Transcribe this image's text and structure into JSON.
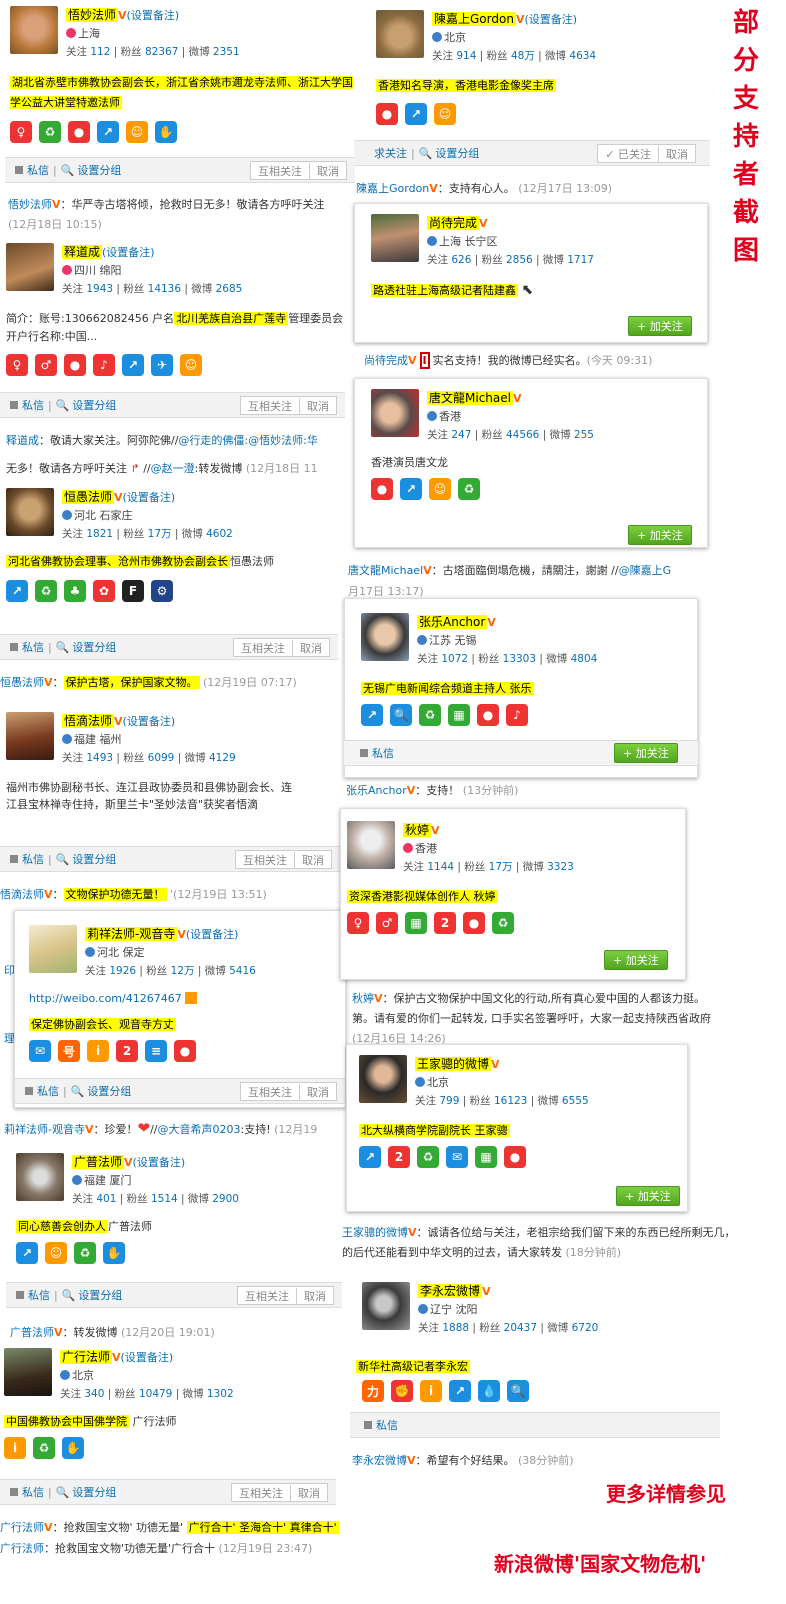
{
  "common": {
    "msg": "私信",
    "group": "设置分组",
    "mutual": "互相关注",
    "cancel": "取消",
    "already": "已关注",
    "follow_btn": "+ 加关注",
    "setnote": "(设置备注)",
    "city_beijing": "北京"
  },
  "cards": {
    "c1": {
      "name": "悟妙法师",
      "loc": "上海",
      "f": "112",
      "fans": "82367",
      "wb": "2351",
      "desc": "湖北省赤壁市佛教协会副会长，浙江省余姚市邇龙寺法师、浙江大学国学公益大讲堂特邀法师"
    },
    "c2": {
      "name": "陳嘉上Gordon",
      "loc": "北京",
      "f": "914",
      "fans": "48万",
      "wb": "4634",
      "desc": "香港知名导演，香港电影金像奖主席"
    },
    "c3": {
      "name": "释道成",
      "loc": "四川 绵阳",
      "f": "1943",
      "fans": "14136",
      "wb": "2685",
      "desc_a": "简介：账号:130662082456 户名",
      "desc_b": "北川羌族自治县广莲寺",
      "desc_c": "管理委员会 开户行名称:中国..."
    },
    "c4": {
      "name": "尚待完成",
      "loc": "上海 长宁区",
      "f": "626",
      "fans": "2856",
      "wb": "1717",
      "desc": "路透社驻上海高级记者陆建鑫"
    },
    "c5": {
      "name": "唐文龍Michael",
      "loc": "香港",
      "f": "247",
      "fans": "44566",
      "wb": "255",
      "desc": "香港演员唐文龙"
    },
    "c6": {
      "name": "恒愚法师",
      "loc": "河北 石家庄",
      "f": "1821",
      "fans": "17万",
      "wb": "4602",
      "desc_a": "河北省佛教协会理事、沧州市佛教协会副会长",
      "desc_b": "恒愚法师"
    },
    "c7": {
      "name": "张乐Anchor",
      "loc": "江苏 无锡",
      "f": "1072",
      "fans": "13303",
      "wb": "4804",
      "desc": "无锡广电新闻综合频道主持人 张乐"
    },
    "c8": {
      "name": "悟滴法师",
      "loc": "福建 福州",
      "f": "1493",
      "fans": "6099",
      "wb": "4129",
      "desc": "福州市佛协副秘书长、连江县政协委员和县佛协副会长、连江县宝林禅寺住持，斯里兰卡\"圣妙法音\"获奖者悟滴"
    },
    "c9": {
      "name": "秋婷",
      "loc": "香港",
      "f": "1144",
      "fans": "17万",
      "wb": "3323",
      "desc": "资深香港影视媒体创作人 秋婷"
    },
    "c10": {
      "name": "莉祥法师-观音寺",
      "loc": "河北 保定",
      "f": "1926",
      "fans": "12万",
      "wb": "5416",
      "url": "http://weibo.com/41267467",
      "desc": "保定佛协副会长、观音寺方丈"
    },
    "c11": {
      "name": "王家骢的微博",
      "loc": "北京",
      "f": "799",
      "fans": "16123",
      "wb": "6555",
      "desc": "北大纵横商学院副院长 王家骢"
    },
    "c12": {
      "name": "广普法师",
      "loc": "福建 厦门",
      "f": "401",
      "fans": "1514",
      "wb": "2900",
      "desc_a": "同心慈善会创办人",
      "desc_b": "广普法师"
    },
    "c13": {
      "name": "李永宏微博",
      "loc": "辽宁 沈阳",
      "f": "1888",
      "fans": "20437",
      "wb": "6720",
      "desc": "新华社高级记者李永宏"
    },
    "c14": {
      "name": "广行法师",
      "loc": "北京",
      "f": "340",
      "fans": "10479",
      "wb": "1302",
      "desc_a": "中国佛教协会中国佛学院",
      "desc_b": " 广行法师"
    }
  },
  "comments": {
    "m1": {
      "u": "悟妙法师",
      "t": "：华严寺古塔将倾，抢救时日无多！敬请各方呼吁关注",
      "d": "(12月18日 10:15)"
    },
    "m2": {
      "u": "陳嘉上Gordon",
      "t": "：支持有心人。",
      "d": "(12月17日 13:09)"
    },
    "m3": {
      "u": "释道成",
      "t": "：敬请大家关注。阿弥陀佛//",
      "t2": "@行走的佛僵",
      "t3": ":@悟妙法师:华",
      "line2": "无多！敬请各方呼吁关注",
      "line2b": "//",
      "line2c": "@赵一澄",
      "line2d": ":转发微博",
      "d": "(12月18日 11"
    },
    "m4": {
      "u": "尚待完成",
      "t": "实名支持！我的微博已经实名。",
      "d": "(今天 09:31)"
    },
    "m5": {
      "u": "唐文龍Michael",
      "t": "：古塔面臨倒塌危機，請關注，謝謝 //",
      "t2": "@陳嘉上G",
      "d": "月17日 13:17)"
    },
    "m6": {
      "u": "恒愚法师",
      "t": "：",
      "hl": "保护古塔，保护国家文物。",
      "d": "(12月19日 07:17)"
    },
    "m7": {
      "u": "张乐Anchor",
      "t": "：支持！",
      "d": "(13分钟前)"
    },
    "m8": {
      "u": "悟滴法师",
      "t": "：",
      "hl": "文物保护功德无量！",
      "d": "'(12月19日 13:51)"
    },
    "m9": {
      "u": "秋婷",
      "t": "：保护古文物保护中国文化的行动,所有真心爱中国的人都该力挺。",
      "line2": "第。请有爱的你们一起转发, 口手实名签署呼吁，大家一起支持陕西省政府",
      "d": "(12月16日 14:26)"
    },
    "m10": {
      "u": "莉祥法师-观音寺",
      "t": "：珍爱！",
      "t2": "//",
      "t3": "@大音希声0203",
      "t4": ":支持!",
      "d": "(12月19"
    },
    "m11": {
      "u": "王家骢的微博",
      "t": "：诚请各位给与关注，老祖宗给我们留下来的东西已经所剩无几，",
      "line2": "的后代还能看到中华文明的过去，请大家转发",
      "d": "(18分钟前)"
    },
    "m12": {
      "u": "广普法师",
      "t": "：转发微博",
      "d": "(12月20日 19:01)"
    },
    "m13": {
      "u": "李永宏微博",
      "t": "：希望有个好结果。",
      "d": "(38分钟前)"
    },
    "m14": {
      "u": "广行法师",
      "t": "：抢救国宝文物' 功德无量'",
      "hl": "广行合十' 圣海合十' 真律合十'"
    },
    "m15": {
      "u": "广行法师",
      "t": "：抢救国宝文物'功德无量'广行合十",
      "d": "(12月19日 23:47)"
    }
  },
  "side": {
    "vertical": [
      "部",
      "分",
      "支",
      "持",
      "者",
      "截",
      "图"
    ],
    "more1": "更多详情参见",
    "more2": "新浪微博'国家文物危机'"
  },
  "stub": {
    "a": "印",
    "b": "理",
    "c": "求关注"
  },
  "labels": {
    "follow": "关注",
    "fans": "粉丝",
    "weibo": "微博"
  },
  "colors": {
    "link": "#0a6fb3",
    "highlight": "#ffff00",
    "verified": "#ff6600",
    "red_text": "#e0001e"
  }
}
